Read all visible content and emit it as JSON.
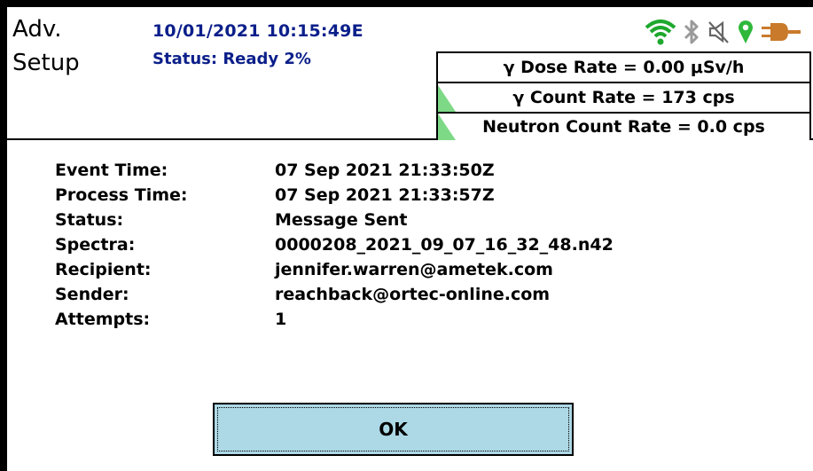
{
  "header": {
    "title_line1": "Adv.",
    "title_line2": "Setup",
    "datetime": "10/01/2021 10:15:49E",
    "status": "Status: Ready 2%"
  },
  "status_icons": [
    "wifi-icon",
    "bluetooth-icon",
    "mute-icon",
    "location-icon",
    "power-plug-icon"
  ],
  "rates": {
    "dose_rate": "γ Dose Rate = 0.00  μSv/h",
    "count_rate": "γ Count Rate = 173 cps",
    "neutron_rate": "Neutron Count Rate = 0.0 cps"
  },
  "details": {
    "rows": [
      {
        "label": "Event Time:",
        "value": "07 Sep 2021 21:33:50Z"
      },
      {
        "label": "Process Time:",
        "value": "07 Sep 2021 21:33:57Z"
      },
      {
        "label": "Status:",
        "value": "Message Sent"
      },
      {
        "label": "Spectra:",
        "value": "0000208_2021_09_07_16_32_48.n42"
      },
      {
        "label": "Recipient:",
        "value": "jennifer.warren@ametek.com"
      },
      {
        "label": "Sender:",
        "value": "reachback@ortec-online.com"
      },
      {
        "label": "Attempts:",
        "value": "1"
      }
    ]
  },
  "buttons": {
    "ok": "OK"
  },
  "colors": {
    "header_blue": "#0b1f8a",
    "wifi_green": "#1ea82e",
    "button_bg": "#add8e6",
    "indicator_green": "#7ed987",
    "plug_orange": "#c97a2b"
  }
}
